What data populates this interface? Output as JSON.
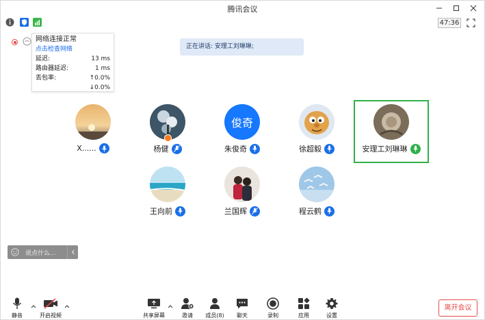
{
  "window": {
    "title": "腾讯会议",
    "timer": "47:36"
  },
  "network_panel": {
    "title": "网络连接正常",
    "check_link": "点击检查网络",
    "rows": [
      {
        "label": "延迟:",
        "value": "13 ms"
      },
      {
        "label": "路由器延迟:",
        "value": "1 ms"
      },
      {
        "label": "丢包率:",
        "value": "↑0.0%"
      },
      {
        "label": "",
        "value": "↓0.0%"
      }
    ]
  },
  "speaking_banner": "正在讲话: 安理工刘琳琳;",
  "participants": [
    {
      "name": "X......",
      "avatar": "sunset-photo",
      "mic": "on"
    },
    {
      "name": "杨健",
      "avatar": "flowers-photo",
      "mic": "off",
      "host": true
    },
    {
      "name": "朱俊奇",
      "avatar": "text-avatar",
      "avatar_text": "俊奇",
      "avatar_color": "#1677ff",
      "mic": "on"
    },
    {
      "name": "徐超毅",
      "avatar": "cartoon-photo",
      "mic": "on"
    },
    {
      "name": "安理工刘琳琳",
      "avatar": "nature-photo",
      "mic": "speaking",
      "active": true
    },
    {
      "name": "王向前",
      "avatar": "beach-photo",
      "mic": "on"
    },
    {
      "name": "兰国辉",
      "avatar": "people-photo",
      "mic": "off"
    },
    {
      "name": "程云鹤",
      "avatar": "birds-photo",
      "mic": "on"
    }
  ],
  "chat": {
    "placeholder": "说点什么..."
  },
  "toolbar": {
    "mute": "静音",
    "video": "开启视频",
    "share": "共享屏幕",
    "invite": "邀请",
    "members": "成员(8)",
    "chat": "聊天",
    "record": "录制",
    "apps": "应用",
    "settings": "设置",
    "leave": "离开会议"
  },
  "colors": {
    "accent": "#1a6fe8",
    "speaking": "#2fb04a",
    "danger": "#e84a4a"
  }
}
